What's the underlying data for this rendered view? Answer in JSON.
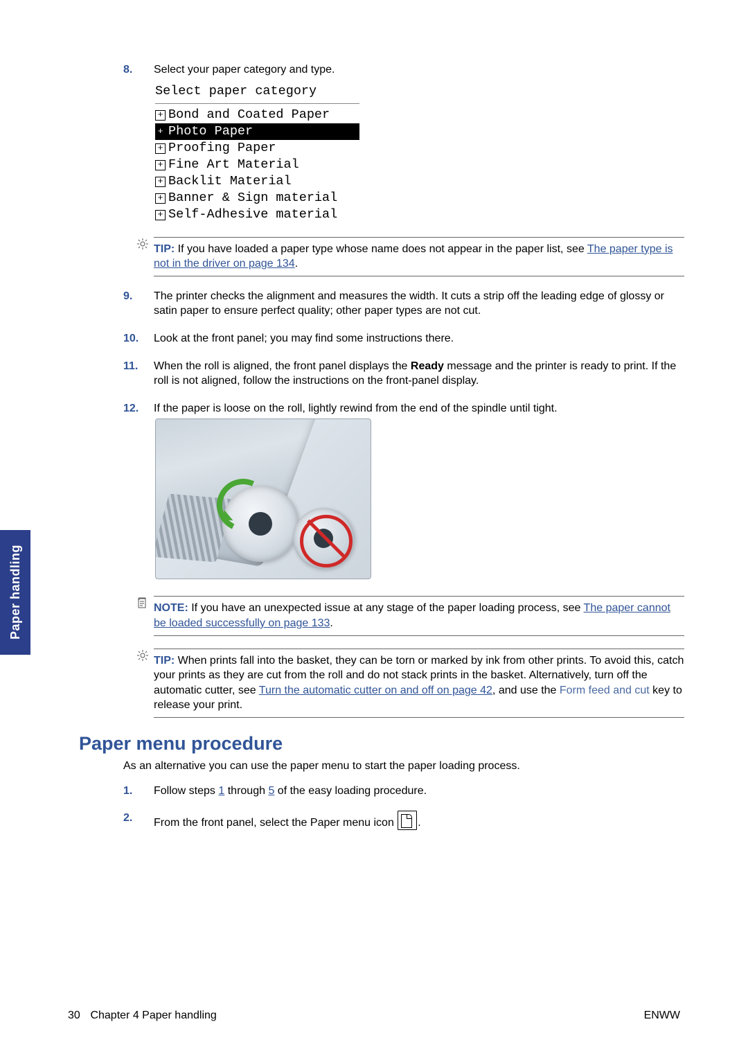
{
  "sidebar": {
    "label": "Paper handling"
  },
  "steps": {
    "n8_num": "8.",
    "n8_text": "Select your paper category and type.",
    "paper_cat_title": "Select paper category",
    "paper_categories": [
      "Bond and Coated Paper",
      "Photo Paper",
      "Proofing Paper",
      "Fine Art Material",
      "Backlit Material",
      "Banner & Sign material",
      "Self-Adhesive material"
    ],
    "tip8_label": "TIP:",
    "tip8_text_a": "If you have loaded a paper type whose name does not appear in the paper list, see ",
    "tip8_link": "The paper type is not in the driver on page 134",
    "tip8_text_b": ".",
    "n9_num": "9.",
    "n9_text": "The printer checks the alignment and measures the width. It cuts a strip off the leading edge of glossy or satin paper to ensure perfect quality; other paper types are not cut.",
    "n10_num": "10.",
    "n10_text": "Look at the front panel; you may find some instructions there.",
    "n11_num": "11.",
    "n11_text_a": "When the roll is aligned, the front panel displays the ",
    "n11_bold": "Ready",
    "n11_text_b": " message and the printer is ready to print. If the roll is not aligned, follow the instructions on the front-panel display.",
    "n12_num": "12.",
    "n12_text": "If the paper is loose on the roll, lightly rewind from the end of the spindle until tight.",
    "note_label": "NOTE:",
    "note_text_a": "If you have an unexpected issue at any stage of the paper loading process, see ",
    "note_link": "The paper cannot be loaded successfully on page 133",
    "note_text_b": ".",
    "tip2_label": "TIP:",
    "tip2_text_a": "When prints fall into the basket, they can be torn or marked by ink from other prints. To avoid this, catch your prints as they are cut from the roll and do not stack prints in the basket. Alternatively, turn off the automatic cutter, see ",
    "tip2_link": "Turn the automatic cutter on and off on page 42",
    "tip2_text_b": ", and use the ",
    "tip2_formfeed": "Form feed and cut",
    "tip2_text_c": " key to release your print."
  },
  "heading": "Paper menu procedure",
  "proc": {
    "intro": "As an alternative you can use the paper menu to start the paper loading process.",
    "n1_num": "1.",
    "n1_text_a": "Follow steps ",
    "n1_link1": "1",
    "n1_text_b": " through ",
    "n1_link2": "5",
    "n1_text_c": " of the easy loading procedure.",
    "n2_num": "2.",
    "n2_text_a": "From the front panel, select the Paper menu icon ",
    "n2_text_b": "."
  },
  "footer": {
    "page_num": "30",
    "chapter": "Chapter 4   Paper handling",
    "right": "ENWW"
  }
}
